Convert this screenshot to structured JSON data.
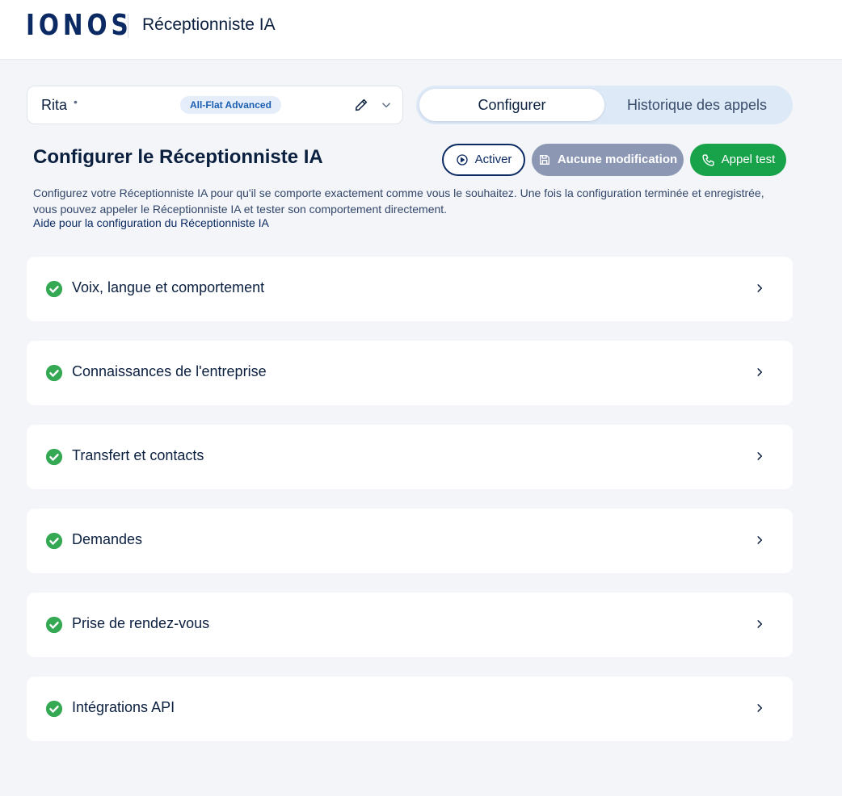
{
  "header": {
    "logo_text": "IONOS",
    "app_title": "Réceptionniste IA"
  },
  "agent": {
    "name": "Rita",
    "separator": "•",
    "plan": "All-Flat Advanced"
  },
  "tabs": [
    {
      "label": "Configurer",
      "active": true
    },
    {
      "label": "Historique des appels",
      "active": false
    }
  ],
  "section": {
    "title": "Configurer le Réceptionniste IA",
    "description": "Configurez votre Réceptionniste IA pour qu'il se comporte exactement comme vous le souhaitez. Une fois la configuration terminée et enregistrée, vous pouvez appeler le Réceptionniste IA et tester son comportement directement.",
    "help_link": "Aide pour la configuration du Réceptionniste IA"
  },
  "actions": {
    "activate": "Activer",
    "no_change": "Aucune modification",
    "test_call": "Appel test"
  },
  "cards": [
    {
      "label": "Voix, langue et comportement",
      "status": "complete"
    },
    {
      "label": "Connaissances de l'entreprise",
      "status": "complete"
    },
    {
      "label": "Transfert et contacts",
      "status": "complete"
    },
    {
      "label": "Demandes",
      "status": "complete"
    },
    {
      "label": "Prise de rendez-vous",
      "status": "complete"
    },
    {
      "label": "Intégrations API",
      "status": "complete"
    }
  ],
  "colors": {
    "brand": "#0b2a63",
    "success": "#18a34a",
    "check": "#34a853",
    "disabled": "#8c97b4",
    "tab_track": "#dde9f7"
  },
  "icons": {
    "edit": "pencil-icon",
    "dropdown": "chevron-down-icon",
    "activate": "play-circle-icon",
    "save": "floppy-disk-icon",
    "phone": "phone-icon",
    "status": "check-circle-icon",
    "open": "chevron-right-icon"
  }
}
